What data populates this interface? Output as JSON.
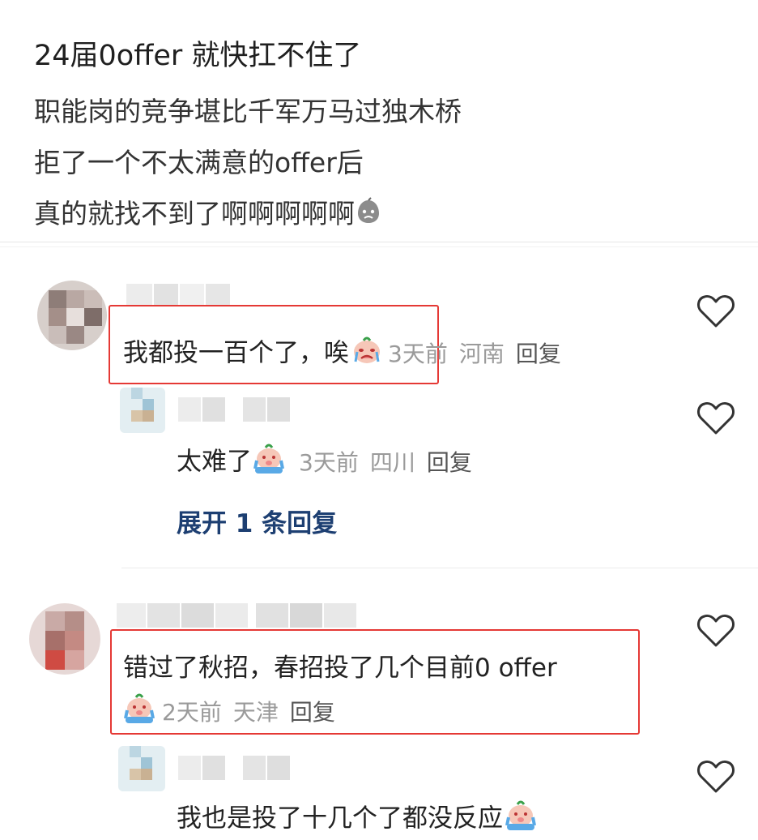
{
  "post": {
    "title": "24届0offer 就快扛不住了",
    "lines": [
      "职能岗的竞争堪比千军万马过独木桥",
      "拒了一个不太满意的offer后",
      "真的就找不到了啊啊啊啊啊"
    ]
  },
  "comments": [
    {
      "text": "我都投一百个了，唉",
      "time": "3天前",
      "location": "河南",
      "reply_label": "回复",
      "reply": {
        "text": "太难了",
        "time": "3天前",
        "location": "四川",
        "reply_label": "回复"
      },
      "expand_label": "展开 1 条回复"
    },
    {
      "text": "错过了秋招，春招投了几个目前0 offer",
      "time": "2天前",
      "location": "天津",
      "reply_label": "回复",
      "reply": {
        "text": "我也是投了十几个了都没反应"
      }
    }
  ],
  "colors": {
    "highlight_box": "#e53935",
    "expand_link": "#1d3f72",
    "meta_text": "#9a9a9a"
  },
  "icons": [
    "like-heart-icon",
    "sad-face-emoji",
    "crying-emoji"
  ]
}
